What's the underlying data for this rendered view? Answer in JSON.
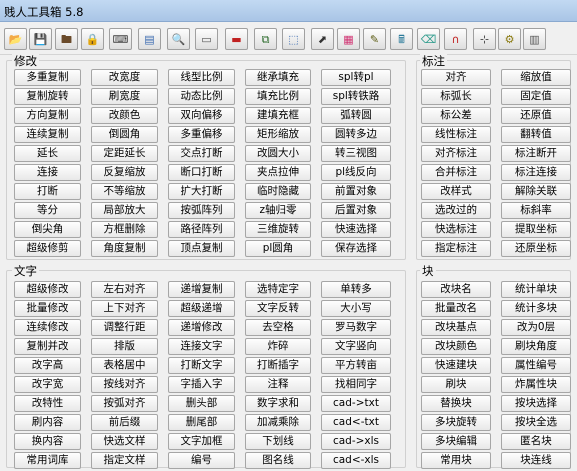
{
  "window": {
    "title": "贱人工具箱 5.8"
  },
  "toolbar": {
    "icons": [
      "open-folder-icon",
      "save-icon",
      "stamp-icon",
      "lock-icon",
      "pdf-icon",
      "image-icon",
      "magnify-icon",
      "ruler-icon",
      "red-block-icon",
      "layer-icon",
      "dashed-select-icon",
      "arrow-icon",
      "color-grid-icon",
      "edit-icon",
      "calculator-icon",
      "eraser-icon",
      "magnet-icon",
      "node-icon",
      "gear-icon",
      "stamp-pad-icon"
    ],
    "glyphs": [
      "📂",
      "💾",
      "🖿",
      "🔒",
      "⌨",
      "▤",
      "🔍",
      "▭",
      "▬",
      "⧉",
      "⬚",
      "⬈",
      "▦",
      "✎",
      "🖩",
      "⌫",
      "∩",
      "⊹",
      "⚙",
      "▥"
    ],
    "colors": [
      "#c89b30",
      "#3b64b8",
      "#6a4a2a",
      "#b58a10",
      "#444444",
      "#3a6ab0",
      "#333333",
      "#555555",
      "#c02020",
      "#2a6a2a",
      "#3a6ab0",
      "#333333",
      "#d03070",
      "#5a5a10",
      "#2a7a9a",
      "#2a9a8a",
      "#c02020",
      "#444444",
      "#8a7a10",
      "#555555"
    ]
  },
  "groups": {
    "xiugai": "修改",
    "biaozhu": "标注",
    "wenzi": "文字",
    "kuai": "块"
  },
  "modify_rows": [
    [
      "多重复制",
      "改宽度",
      "线型比例",
      "继承填充",
      "spl转pl"
    ],
    [
      "复制旋转",
      "刷宽度",
      "动态比例",
      "填充比例",
      "spl转铁路"
    ],
    [
      "方向复制",
      "改颜色",
      "双向偏移",
      "建填充框",
      "弧转圆"
    ],
    [
      "连续复制",
      "倒圆角",
      "多重偏移",
      "矩形缩放",
      "圆转多边"
    ],
    [
      "延长",
      "定距延长",
      "交点打断",
      "改圆大小",
      "转三视图"
    ],
    [
      "连接",
      "反复缩放",
      "断口打断",
      "夹点拉伸",
      "pl线反向"
    ],
    [
      "打断",
      "不等缩放",
      "扩大打断",
      "临时隐藏",
      "前置对象"
    ],
    [
      "等分",
      "局部放大",
      "按弧阵列",
      "z轴归零",
      "后置对象"
    ],
    [
      "倒尖角",
      "方框删除",
      "路径阵列",
      "三维旋转",
      "快速选择"
    ],
    [
      "超级修剪",
      "角度复制",
      "顶点复制",
      "pl圆角",
      "保存选择"
    ]
  ],
  "dim_rows": [
    [
      "对齐",
      "缩放值"
    ],
    [
      "标弧长",
      "固定值"
    ],
    [
      "标公差",
      "还原值"
    ],
    [
      "线性标注",
      "翻转值"
    ],
    [
      "对齐标注",
      "标注断开"
    ],
    [
      "合并标注",
      "标注连接"
    ],
    [
      "改样式",
      "解除关联"
    ],
    [
      "选改过的",
      "标斜率"
    ],
    [
      "快选标注",
      "提取坐标"
    ],
    [
      "指定标注",
      "还原坐标"
    ]
  ],
  "text_rows": [
    [
      "超级修改",
      "左右对齐",
      "递增复制",
      "选特定字",
      "单转多"
    ],
    [
      "批量修改",
      "上下对齐",
      "超级递增",
      "文字反转",
      "大小写"
    ],
    [
      "连续修改",
      "调整行距",
      "递增修改",
      "去空格",
      "罗马数字"
    ],
    [
      "复制并改",
      "排版",
      "连接文字",
      "炸碎",
      "文字竖向"
    ],
    [
      "改字高",
      "表格居中",
      "打断文字",
      "打断插字",
      "平方转亩"
    ],
    [
      "改字宽",
      "按线对齐",
      "字插入字",
      "注释",
      "找相同字"
    ],
    [
      "改特性",
      "按弧对齐",
      "删头部",
      "数字求和",
      "cad->txt"
    ],
    [
      "刷内容",
      "前后缀",
      "删尾部",
      "加减乘除",
      "cad<-txt"
    ],
    [
      "换内容",
      "快选文样",
      "文字加框",
      "下划线",
      "cad->xls"
    ],
    [
      "常用词库",
      "指定文样",
      "编号",
      "图名线",
      "cad<-xls"
    ]
  ],
  "block_rows": [
    [
      "改块名",
      "统计单块"
    ],
    [
      "批量改名",
      "统计多块"
    ],
    [
      "改块基点",
      "改为0层"
    ],
    [
      "改块颜色",
      "刷块角度"
    ],
    [
      "快速建块",
      "属性编号"
    ],
    [
      "刷块",
      "炸属性块"
    ],
    [
      "替换块",
      "按块选择"
    ],
    [
      "多块旋转",
      "按块全选"
    ],
    [
      "多块编辑",
      "匿名块"
    ],
    [
      "常用块",
      "块连线"
    ]
  ]
}
